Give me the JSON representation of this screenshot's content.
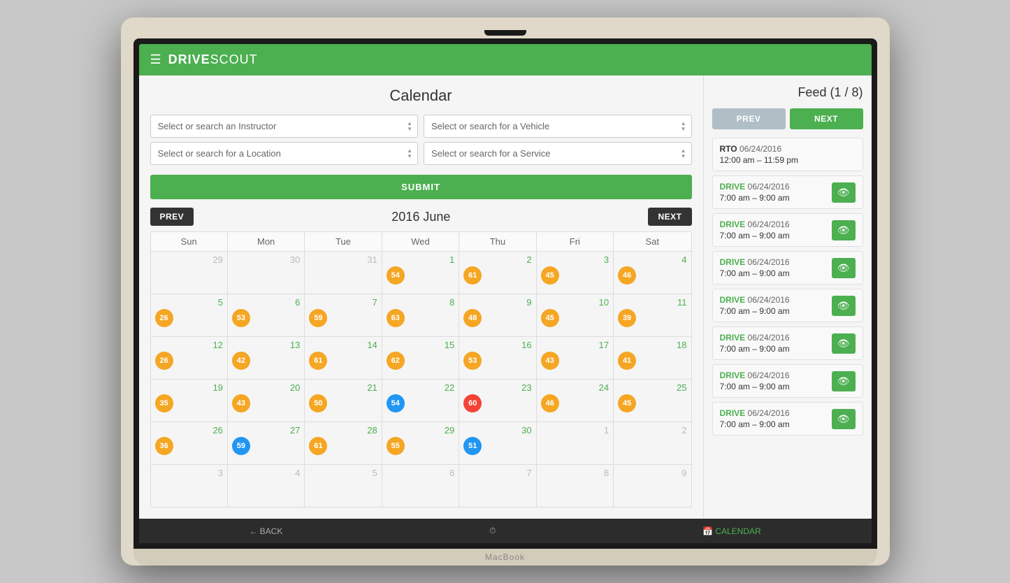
{
  "app": {
    "logo_drive": "DRIVE",
    "logo_scout": "SCOUT",
    "hamburger": "☰"
  },
  "header": {
    "title": "Calendar",
    "feed_title": "Feed",
    "feed_count": "(1 / 8)"
  },
  "filters": {
    "instructor_placeholder": "Select or search an Instructor",
    "location_placeholder": "Select or search for a Location",
    "vehicle_placeholder": "Select or search for a Vehicle",
    "service_placeholder": "Select or search for a Service",
    "submit_label": "SUBMIT"
  },
  "calendar": {
    "prev_label": "PREV",
    "next_label": "NEXT",
    "month_title": "2016 June",
    "days_of_week": [
      "Sun",
      "Mon",
      "Tue",
      "Wed",
      "Thu",
      "Fri",
      "Sat"
    ],
    "weeks": [
      [
        {
          "num": "29",
          "inactive": true,
          "badge": null
        },
        {
          "num": "30",
          "inactive": true,
          "badge": null
        },
        {
          "num": "31",
          "inactive": true,
          "badge": null
        },
        {
          "num": "1",
          "inactive": false,
          "badge": {
            "val": "54",
            "color": "yellow"
          }
        },
        {
          "num": "2",
          "inactive": false,
          "badge": {
            "val": "61",
            "color": "yellow"
          }
        },
        {
          "num": "3",
          "inactive": false,
          "badge": {
            "val": "45",
            "color": "yellow"
          }
        },
        {
          "num": "4",
          "inactive": false,
          "badge": {
            "val": "46",
            "color": "yellow"
          }
        }
      ],
      [
        {
          "num": "5",
          "inactive": false,
          "badge": {
            "val": "26",
            "color": "yellow"
          }
        },
        {
          "num": "6",
          "inactive": false,
          "badge": {
            "val": "53",
            "color": "yellow"
          }
        },
        {
          "num": "7",
          "inactive": false,
          "badge": {
            "val": "59",
            "color": "yellow"
          }
        },
        {
          "num": "8",
          "inactive": false,
          "badge": {
            "val": "63",
            "color": "yellow"
          }
        },
        {
          "num": "9",
          "inactive": false,
          "badge": {
            "val": "48",
            "color": "yellow"
          }
        },
        {
          "num": "10",
          "inactive": false,
          "badge": {
            "val": "45",
            "color": "yellow"
          }
        },
        {
          "num": "11",
          "inactive": false,
          "badge": {
            "val": "39",
            "color": "yellow"
          }
        }
      ],
      [
        {
          "num": "12",
          "inactive": false,
          "badge": {
            "val": "26",
            "color": "yellow"
          }
        },
        {
          "num": "13",
          "inactive": false,
          "badge": {
            "val": "42",
            "color": "yellow"
          }
        },
        {
          "num": "14",
          "inactive": false,
          "badge": {
            "val": "61",
            "color": "yellow"
          }
        },
        {
          "num": "15",
          "inactive": false,
          "badge": {
            "val": "62",
            "color": "yellow"
          }
        },
        {
          "num": "16",
          "inactive": false,
          "badge": {
            "val": "53",
            "color": "yellow"
          }
        },
        {
          "num": "17",
          "inactive": false,
          "badge": {
            "val": "43",
            "color": "yellow"
          }
        },
        {
          "num": "18",
          "inactive": false,
          "badge": {
            "val": "41",
            "color": "yellow"
          }
        }
      ],
      [
        {
          "num": "19",
          "inactive": false,
          "badge": {
            "val": "35",
            "color": "yellow"
          }
        },
        {
          "num": "20",
          "inactive": false,
          "badge": {
            "val": "43",
            "color": "yellow"
          }
        },
        {
          "num": "21",
          "inactive": false,
          "badge": {
            "val": "50",
            "color": "yellow"
          }
        },
        {
          "num": "22",
          "inactive": false,
          "badge": {
            "val": "54",
            "color": "blue"
          }
        },
        {
          "num": "23",
          "inactive": false,
          "badge": {
            "val": "60",
            "color": "red"
          }
        },
        {
          "num": "24",
          "inactive": false,
          "badge": {
            "val": "46",
            "color": "yellow"
          }
        },
        {
          "num": "25",
          "inactive": false,
          "badge": {
            "val": "45",
            "color": "yellow"
          }
        }
      ],
      [
        {
          "num": "26",
          "inactive": false,
          "badge": {
            "val": "36",
            "color": "yellow"
          }
        },
        {
          "num": "27",
          "inactive": false,
          "badge": {
            "val": "59",
            "color": "blue"
          }
        },
        {
          "num": "28",
          "inactive": false,
          "badge": {
            "val": "61",
            "color": "yellow"
          }
        },
        {
          "num": "29",
          "inactive": false,
          "badge": {
            "val": "55",
            "color": "yellow"
          }
        },
        {
          "num": "30",
          "inactive": false,
          "badge": {
            "val": "51",
            "color": "blue"
          }
        },
        {
          "num": "1",
          "inactive": true,
          "badge": null
        },
        {
          "num": "2",
          "inactive": true,
          "badge": null
        }
      ],
      [
        {
          "num": "3",
          "inactive": true,
          "badge": null
        },
        {
          "num": "4",
          "inactive": true,
          "badge": null
        },
        {
          "num": "5",
          "inactive": true,
          "badge": null
        },
        {
          "num": "6",
          "inactive": true,
          "badge": null
        },
        {
          "num": "7",
          "inactive": true,
          "badge": null
        },
        {
          "num": "8",
          "inactive": true,
          "badge": null
        },
        {
          "num": "9",
          "inactive": true,
          "badge": null
        }
      ]
    ]
  },
  "feed": {
    "prev_label": "PREV",
    "next_label": "NEXT",
    "rto": {
      "label": "RTO",
      "date": "06/24/2016",
      "time": "12:00 am – 11:59 pm"
    },
    "drives": [
      {
        "label": "DRIVE",
        "date": "06/24/2016",
        "time": "7:00 am – 9:00 am"
      },
      {
        "label": "DRIVE",
        "date": "06/24/2016",
        "time": "7:00 am – 9:00 am"
      },
      {
        "label": "DRIVE",
        "date": "06/24/2016",
        "time": "7:00 am – 9:00 am"
      },
      {
        "label": "DRIVE",
        "date": "06/24/2016",
        "time": "7:00 am – 9:00 am"
      },
      {
        "label": "DRIVE",
        "date": "06/24/2016",
        "time": "7:00 am – 9:00 am"
      },
      {
        "label": "DRIVE",
        "date": "06/24/2016",
        "time": "7:00 am – 9:00 am"
      },
      {
        "label": "DRIVE",
        "date": "06/24/2016",
        "time": "7:00 am – 9:00 am"
      }
    ]
  },
  "bottom_nav": {
    "back_label": "← BACK",
    "calendar_label": "📅 CALENDAR",
    "center_icon": "⏱"
  }
}
